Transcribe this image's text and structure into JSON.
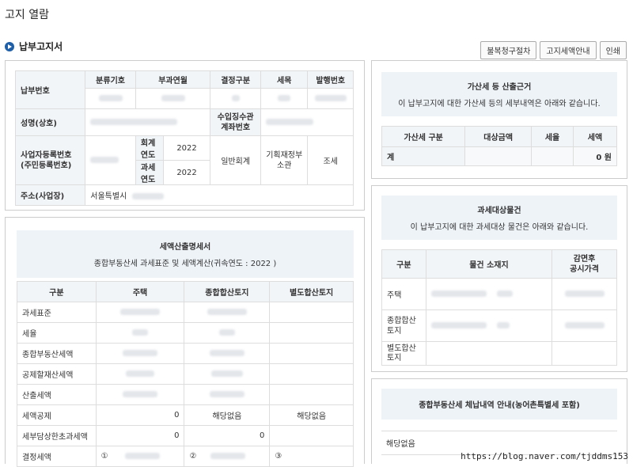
{
  "page": {
    "title": "고지 열람"
  },
  "section": {
    "title": "납부고지서"
  },
  "buttons": {
    "appeal": "불복청구절차",
    "guide": "고지세액안내",
    "print": "인쇄"
  },
  "notice": {
    "label_number": "납부번호",
    "col_class": "분류기호",
    "col_month": "부과연월",
    "col_decision": "결정구분",
    "col_item": "세목",
    "col_issue": "발행번호",
    "label_name": "성명(상호)",
    "label_account": "수입징수관\n계좌번호",
    "label_bizno": "사업자등록번호\n(주민등록번호)",
    "label_fiscal_year": "회계연도",
    "fiscal_year": "2022",
    "label_tax_year": "과세연도",
    "tax_year": "2022",
    "general_account": "일반회계",
    "ministry": "기획재정부\n소관",
    "tax": "조세",
    "label_address": "주소(사업장)",
    "address": "서울특별시"
  },
  "penalty": {
    "title": "가산세 등 산출근거",
    "subtitle": "이 납부고지에 대한 가산세 등의 세부내역은 아래와 같습니다.",
    "headers": [
      "가산세 구분",
      "대상금액",
      "세율",
      "세액"
    ],
    "total_label": "계",
    "total_value": "0 원"
  },
  "calc": {
    "title": "세액산출명세서",
    "subtitle": "종합부동산세 과세표준 및 세액계산(귀속연도 : 2022 )",
    "headers": [
      "구분",
      "주택",
      "종합합산토지",
      "별도합산토지"
    ],
    "rows": [
      {
        "label": "과세표준",
        "c1": "",
        "c2": "",
        "c3": ""
      },
      {
        "label": "세율",
        "c1": "",
        "c2": "",
        "c3": ""
      },
      {
        "label": "종합부동산세액",
        "c1": "",
        "c2": "",
        "c3": ""
      },
      {
        "label": "공제할재산세액",
        "c1": "",
        "c2": "",
        "c3": ""
      },
      {
        "label": "산출세액",
        "c1": "",
        "c2": "",
        "c3": ""
      },
      {
        "label": "세액공제",
        "c1": "0",
        "c2": "해당없음",
        "c3": "해당없음"
      },
      {
        "label": "세부담상한초과세액",
        "c1": "0",
        "c2": "0",
        "c3": ""
      },
      {
        "label": "결정세액",
        "c1": "①",
        "c2": "②",
        "c3": "③"
      }
    ]
  },
  "objects": {
    "title": "과세대상물건",
    "subtitle": "이 납부고지에 대한 과세대상 물건은 아래와 같습니다.",
    "headers": [
      "구분",
      "물건 소재지",
      "감면후\n공시가격"
    ],
    "rows": [
      "주택",
      "종합합산\n토지",
      "별도합산\n토지"
    ]
  },
  "arrears": {
    "title": "종합부동산세 체납내역 안내(농어촌특별세 포함)",
    "value": "해당없음"
  },
  "watermark": "https://blog.naver.com/tjddms153"
}
